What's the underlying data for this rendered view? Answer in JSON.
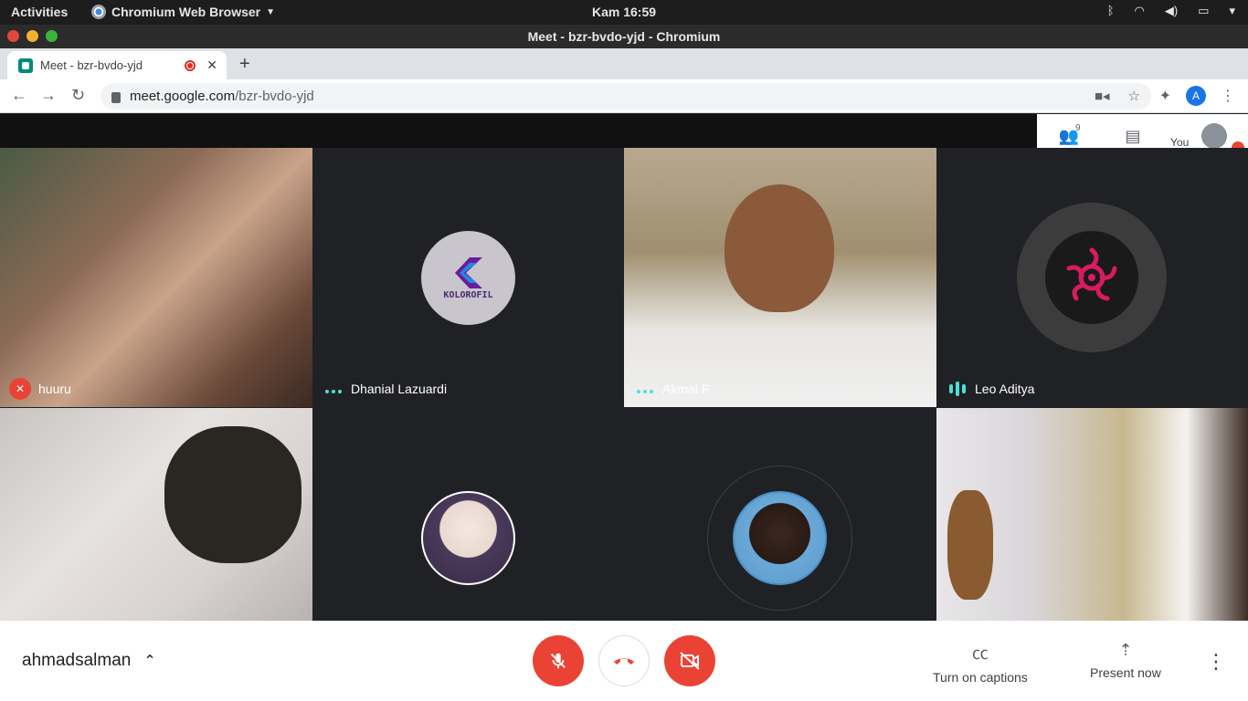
{
  "system_bar": {
    "activities": "Activities",
    "app_name": "Chromium Web Browser",
    "clock": "Kam 16:59"
  },
  "window": {
    "title": "Meet - bzr-bvdo-yjd - Chromium"
  },
  "tab": {
    "title": "Meet - bzr-bvdo-yjd"
  },
  "address": {
    "host": "meet.google.com",
    "path": "/bzr-bvdo-yjd"
  },
  "profile": {
    "initial": "A"
  },
  "panel": {
    "participant_count": "9",
    "you_label": "You"
  },
  "participants": [
    {
      "name": "huuru",
      "status": "muted"
    },
    {
      "name": "Dhanial Lazuardi",
      "status": "idle",
      "avatar_text": "KOLOROFIL"
    },
    {
      "name": "Akmal F",
      "status": "idle"
    },
    {
      "name": "Leo Aditya",
      "status": "speaking"
    },
    {
      "name": "",
      "status": "video"
    },
    {
      "name": "",
      "status": "avatar"
    },
    {
      "name": "",
      "status": "avatar"
    },
    {
      "name": "",
      "status": "video"
    }
  ],
  "bottom": {
    "meeting_name": "ahmadsalman",
    "captions_label": "Turn on captions",
    "present_label": "Present now"
  },
  "colors": {
    "danger": "#ea4335",
    "accent": "#1a73e8",
    "speaking": "#4de0d6"
  },
  "icons": [
    "mic-off-icon",
    "hangup-icon",
    "camera-off-icon",
    "captions-icon",
    "present-icon",
    "people-icon",
    "chat-icon",
    "more-icon"
  ]
}
